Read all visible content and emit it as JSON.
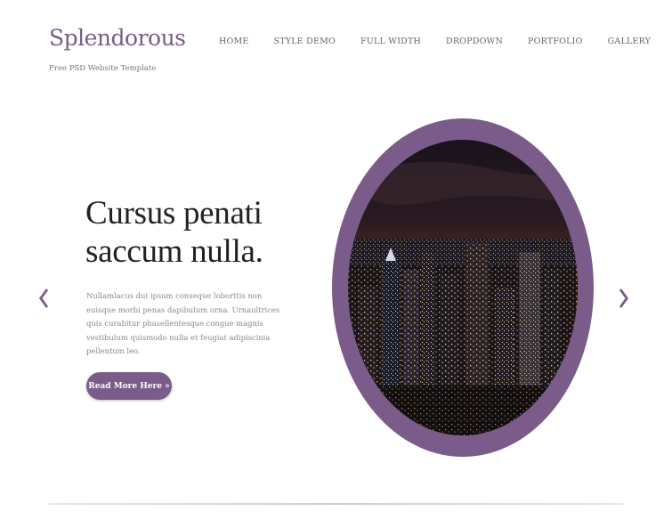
{
  "header": {
    "logo": "Splendorous",
    "tagline": "Free PSD Website Template"
  },
  "nav": {
    "items": [
      {
        "label": "HOME"
      },
      {
        "label": "STYLE DEMO"
      },
      {
        "label": "FULL WIDTH"
      },
      {
        "label": "DROPDOWN"
      },
      {
        "label": "PORTFOLIO"
      },
      {
        "label": "GALLERY"
      }
    ]
  },
  "slider": {
    "headline_line1": "Cursus penati",
    "headline_line2": "saccum nulla.",
    "body": "Nullamlacus dui ipsum conseque loborttis non euisque morbi penas dapibulum orna. Urnaultrices quis curabitur phasellentesque congue magnis vestibulum quismodo nulla et feugiat adipiscinia pellentum leo.",
    "cta_label": "Read More Here »",
    "prev_icon": "chevron-left-icon",
    "next_icon": "chevron-right-icon",
    "image_subject": "night city skyline"
  },
  "colors": {
    "accent": "#7a5b8a",
    "headline": "#222222",
    "body_text": "#888888",
    "nav_text": "#666666"
  }
}
